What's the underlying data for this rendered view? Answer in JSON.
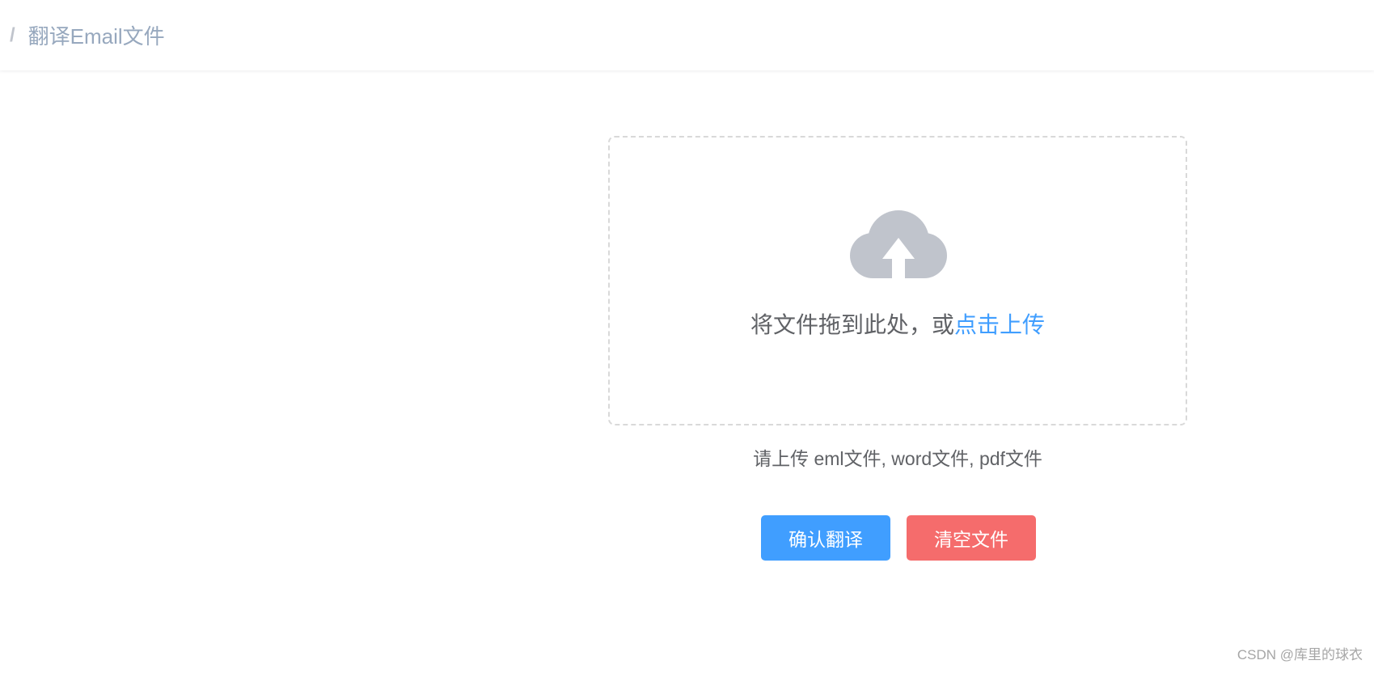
{
  "breadcrumb": {
    "separator": "/",
    "current": "翻译Email文件"
  },
  "upload": {
    "icon": "upload-cloud-icon",
    "text": "将文件拖到此处，或",
    "link_text": "点击上传",
    "tip": "请上传 eml文件, word文件, pdf文件"
  },
  "actions": {
    "confirm_label": "确认翻译",
    "clear_label": "清空文件"
  },
  "watermark": "CSDN @库里的球衣",
  "colors": {
    "primary": "#409eff",
    "danger": "#f56c6c",
    "icon_gray": "#c0c4cc",
    "breadcrumb_text": "#97a8be"
  }
}
